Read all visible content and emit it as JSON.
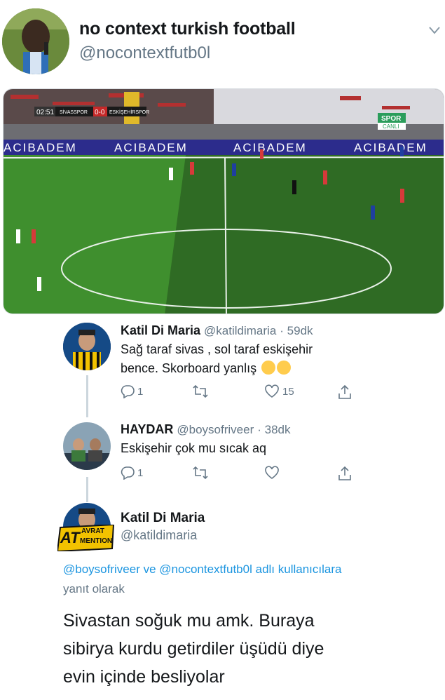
{
  "header": {
    "name": "no context turkish football",
    "handle": "@nocontextfutb0l"
  },
  "match_image": {
    "clock": "02:51",
    "home": "SİVASSPOR",
    "score": "0-0",
    "away": "ESKİŞEHİRSPOR",
    "channel": "SPOR",
    "channel_sub": "CANLI",
    "board_text": "ACIBADEM"
  },
  "replies": [
    {
      "name": "Katil Di Maria",
      "handle": "@katildimaria",
      "time": "· 59dk",
      "text_line1": "Sağ taraf sivas , sol taraf eskişehir",
      "text_line2": "bence. Skorboard yanlış",
      "reply_count": "1",
      "retweet_count": "",
      "like_count": "15"
    },
    {
      "name": "HAYDAR",
      "handle": "@boysofriveer",
      "time": "· 38dk",
      "text_line1": "Eskişehir çok mu sıcak aq",
      "reply_count": "1",
      "retweet_count": "",
      "like_count": ""
    }
  ],
  "main_tweet": {
    "name": "Katil Di Maria",
    "handle": "@katildimaria",
    "avatar_badge_line1": "AT",
    "avatar_badge_line2": "AVRAT",
    "avatar_badge_line3": "MENTION",
    "replying_mention1": "@boysofriveer",
    "replying_and": "ve",
    "replying_mention2": "@nocontextfutb0l",
    "replying_adli": "adlı",
    "replying_users": "kullanıcılara",
    "replying_suffix": "yanıt olarak",
    "text_line1": "Sivastan soğuk mu amk. Buraya",
    "text_line2": "sibirya kurdu getirdiler üşüdü diye",
    "text_line3": "evin içinde besliyolar"
  },
  "colors": {
    "link": "#1b95e0",
    "muted": "#657786",
    "pitch": "#3f8f2e",
    "board": "#2c2c8c"
  }
}
